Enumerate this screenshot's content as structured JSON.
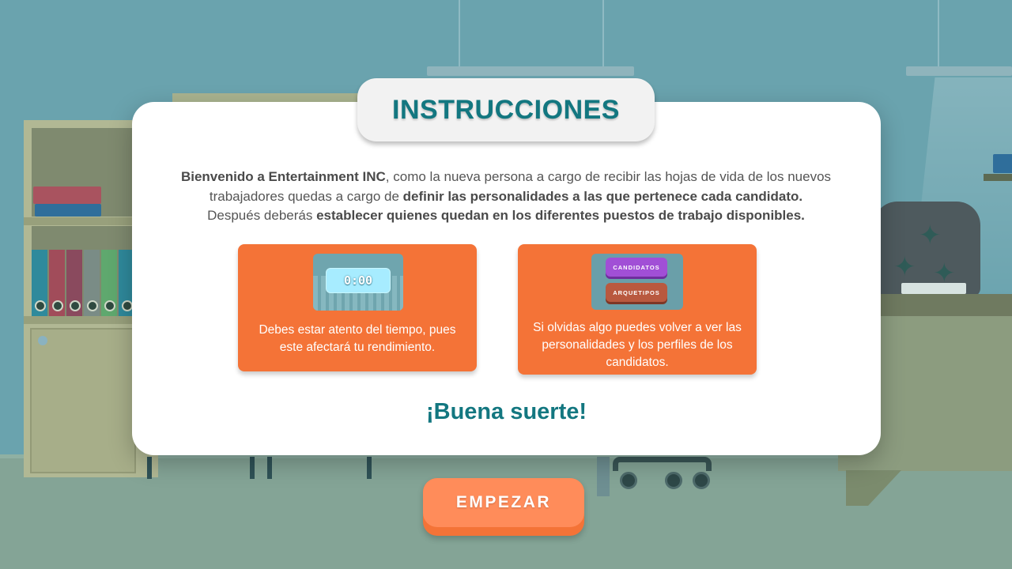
{
  "title": "INSTRUCCIONES",
  "intro": {
    "p1_bold": "Bienvenido a Entertainment INC",
    "p1_text": ", como la nueva persona a cargo de recibir las hojas de vida de los nuevos trabajadores quedas a cargo de ",
    "p1_bold2": "definir las personalidades a las que pertenece cada candidato.",
    "p2_text": "Después deberás ",
    "p2_bold": "establecer quienes quedan en los diferentes puestos de trabajo disponibles."
  },
  "cards": [
    {
      "thumbnail_timer": "0:00",
      "text": "Debes estar atento del tiempo, pues este afectará tu rendimiento."
    },
    {
      "thumbnail_buttons": [
        "CANDIDATOS",
        "ARQUETIPOS"
      ],
      "text": "Si olvidas algo puedes volver a ver las personalidades y los perfiles de los candidatos."
    }
  ],
  "closing": "¡Buena suerte!",
  "start_button": "EMPEZAR",
  "colors": {
    "accent_teal": "#137780",
    "card_orange": "#f47337",
    "button_orange": "#ff8c5a",
    "background_wall": "#6aa3ae"
  }
}
